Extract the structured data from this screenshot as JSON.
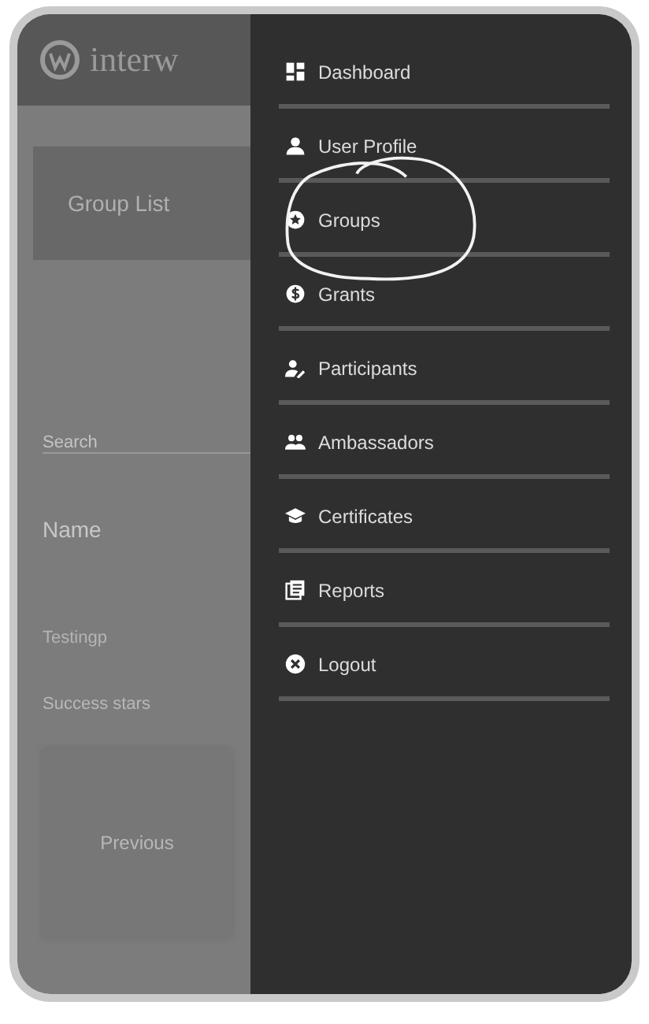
{
  "header": {
    "logo_text": "interw"
  },
  "page": {
    "title": "Group List",
    "search": {
      "placeholder": "Search"
    },
    "column_label": "Name",
    "row_name": "Testingp",
    "stars_label": "Success stars",
    "button": "Previous"
  },
  "drawer": {
    "items": [
      {
        "label": "Dashboard",
        "kind": "dashboard"
      },
      {
        "label": "User Profile",
        "kind": "profile"
      },
      {
        "label": "Groups",
        "kind": "groups"
      },
      {
        "label": "Grants",
        "kind": "grants"
      },
      {
        "label": "Participants",
        "kind": "participants"
      },
      {
        "label": "Ambassadors",
        "kind": "ambassadors"
      },
      {
        "label": "Certificates",
        "kind": "certificates"
      },
      {
        "label": "Reports",
        "kind": "reports"
      },
      {
        "label": "Logout",
        "kind": "logout"
      }
    ]
  }
}
